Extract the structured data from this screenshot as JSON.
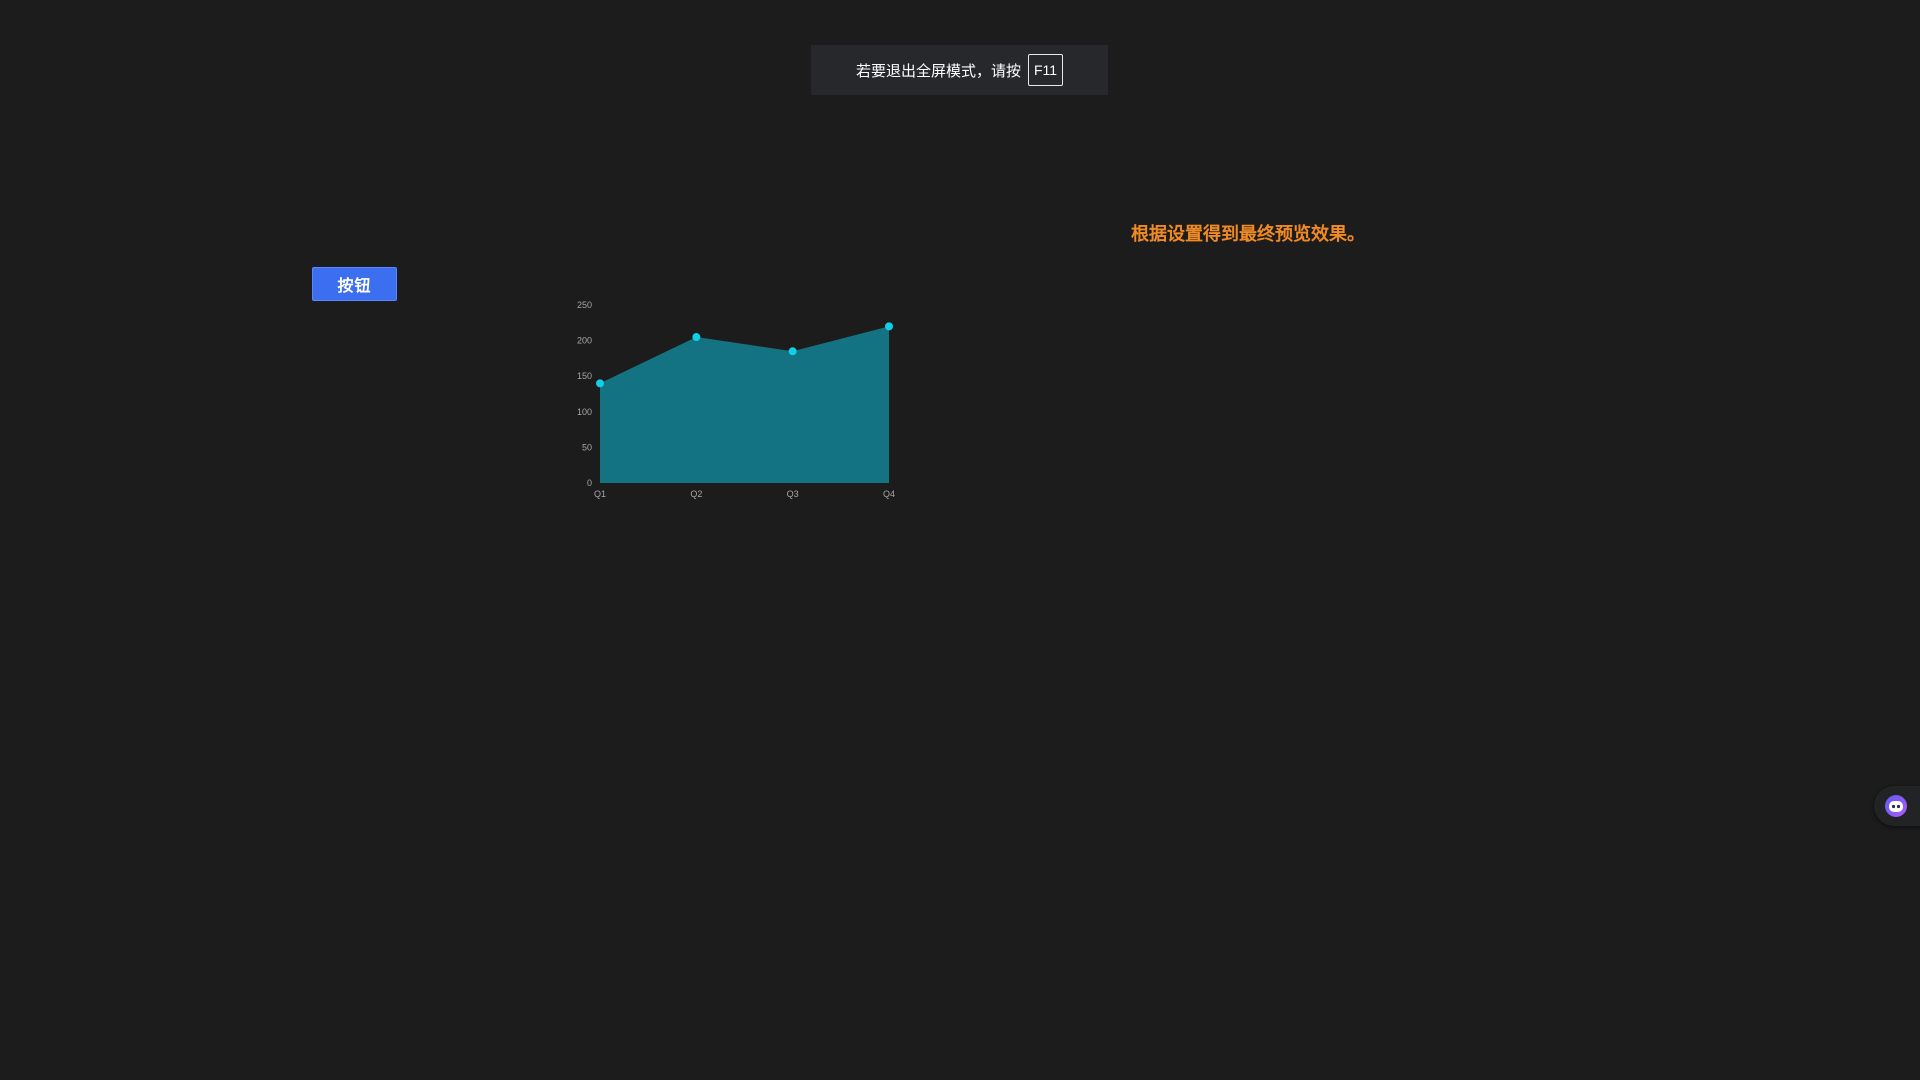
{
  "fullscreen_notice": {
    "text": "若要退出全屏模式，请按",
    "key": "F11"
  },
  "hint_text": "根据设置得到最终预览效果。",
  "button_label": "按钮",
  "chart_data": {
    "type": "area",
    "categories": [
      "Q1",
      "Q2",
      "Q3",
      "Q4"
    ],
    "values": [
      140,
      205,
      185,
      220
    ],
    "ylim": [
      0,
      250
    ],
    "yticks": [
      0,
      50,
      100,
      150,
      200,
      250
    ],
    "title": "",
    "xlabel": "",
    "ylabel": "",
    "grid": false,
    "colors": {
      "area": "#137383",
      "points": "#11cfe6",
      "ticks": "#a7a7a7"
    }
  },
  "assistant": {
    "icon": "assistant-robot-icon",
    "colors": {
      "gradient_start": "#5d5cf5",
      "gradient_end": "#b05bf3"
    }
  }
}
